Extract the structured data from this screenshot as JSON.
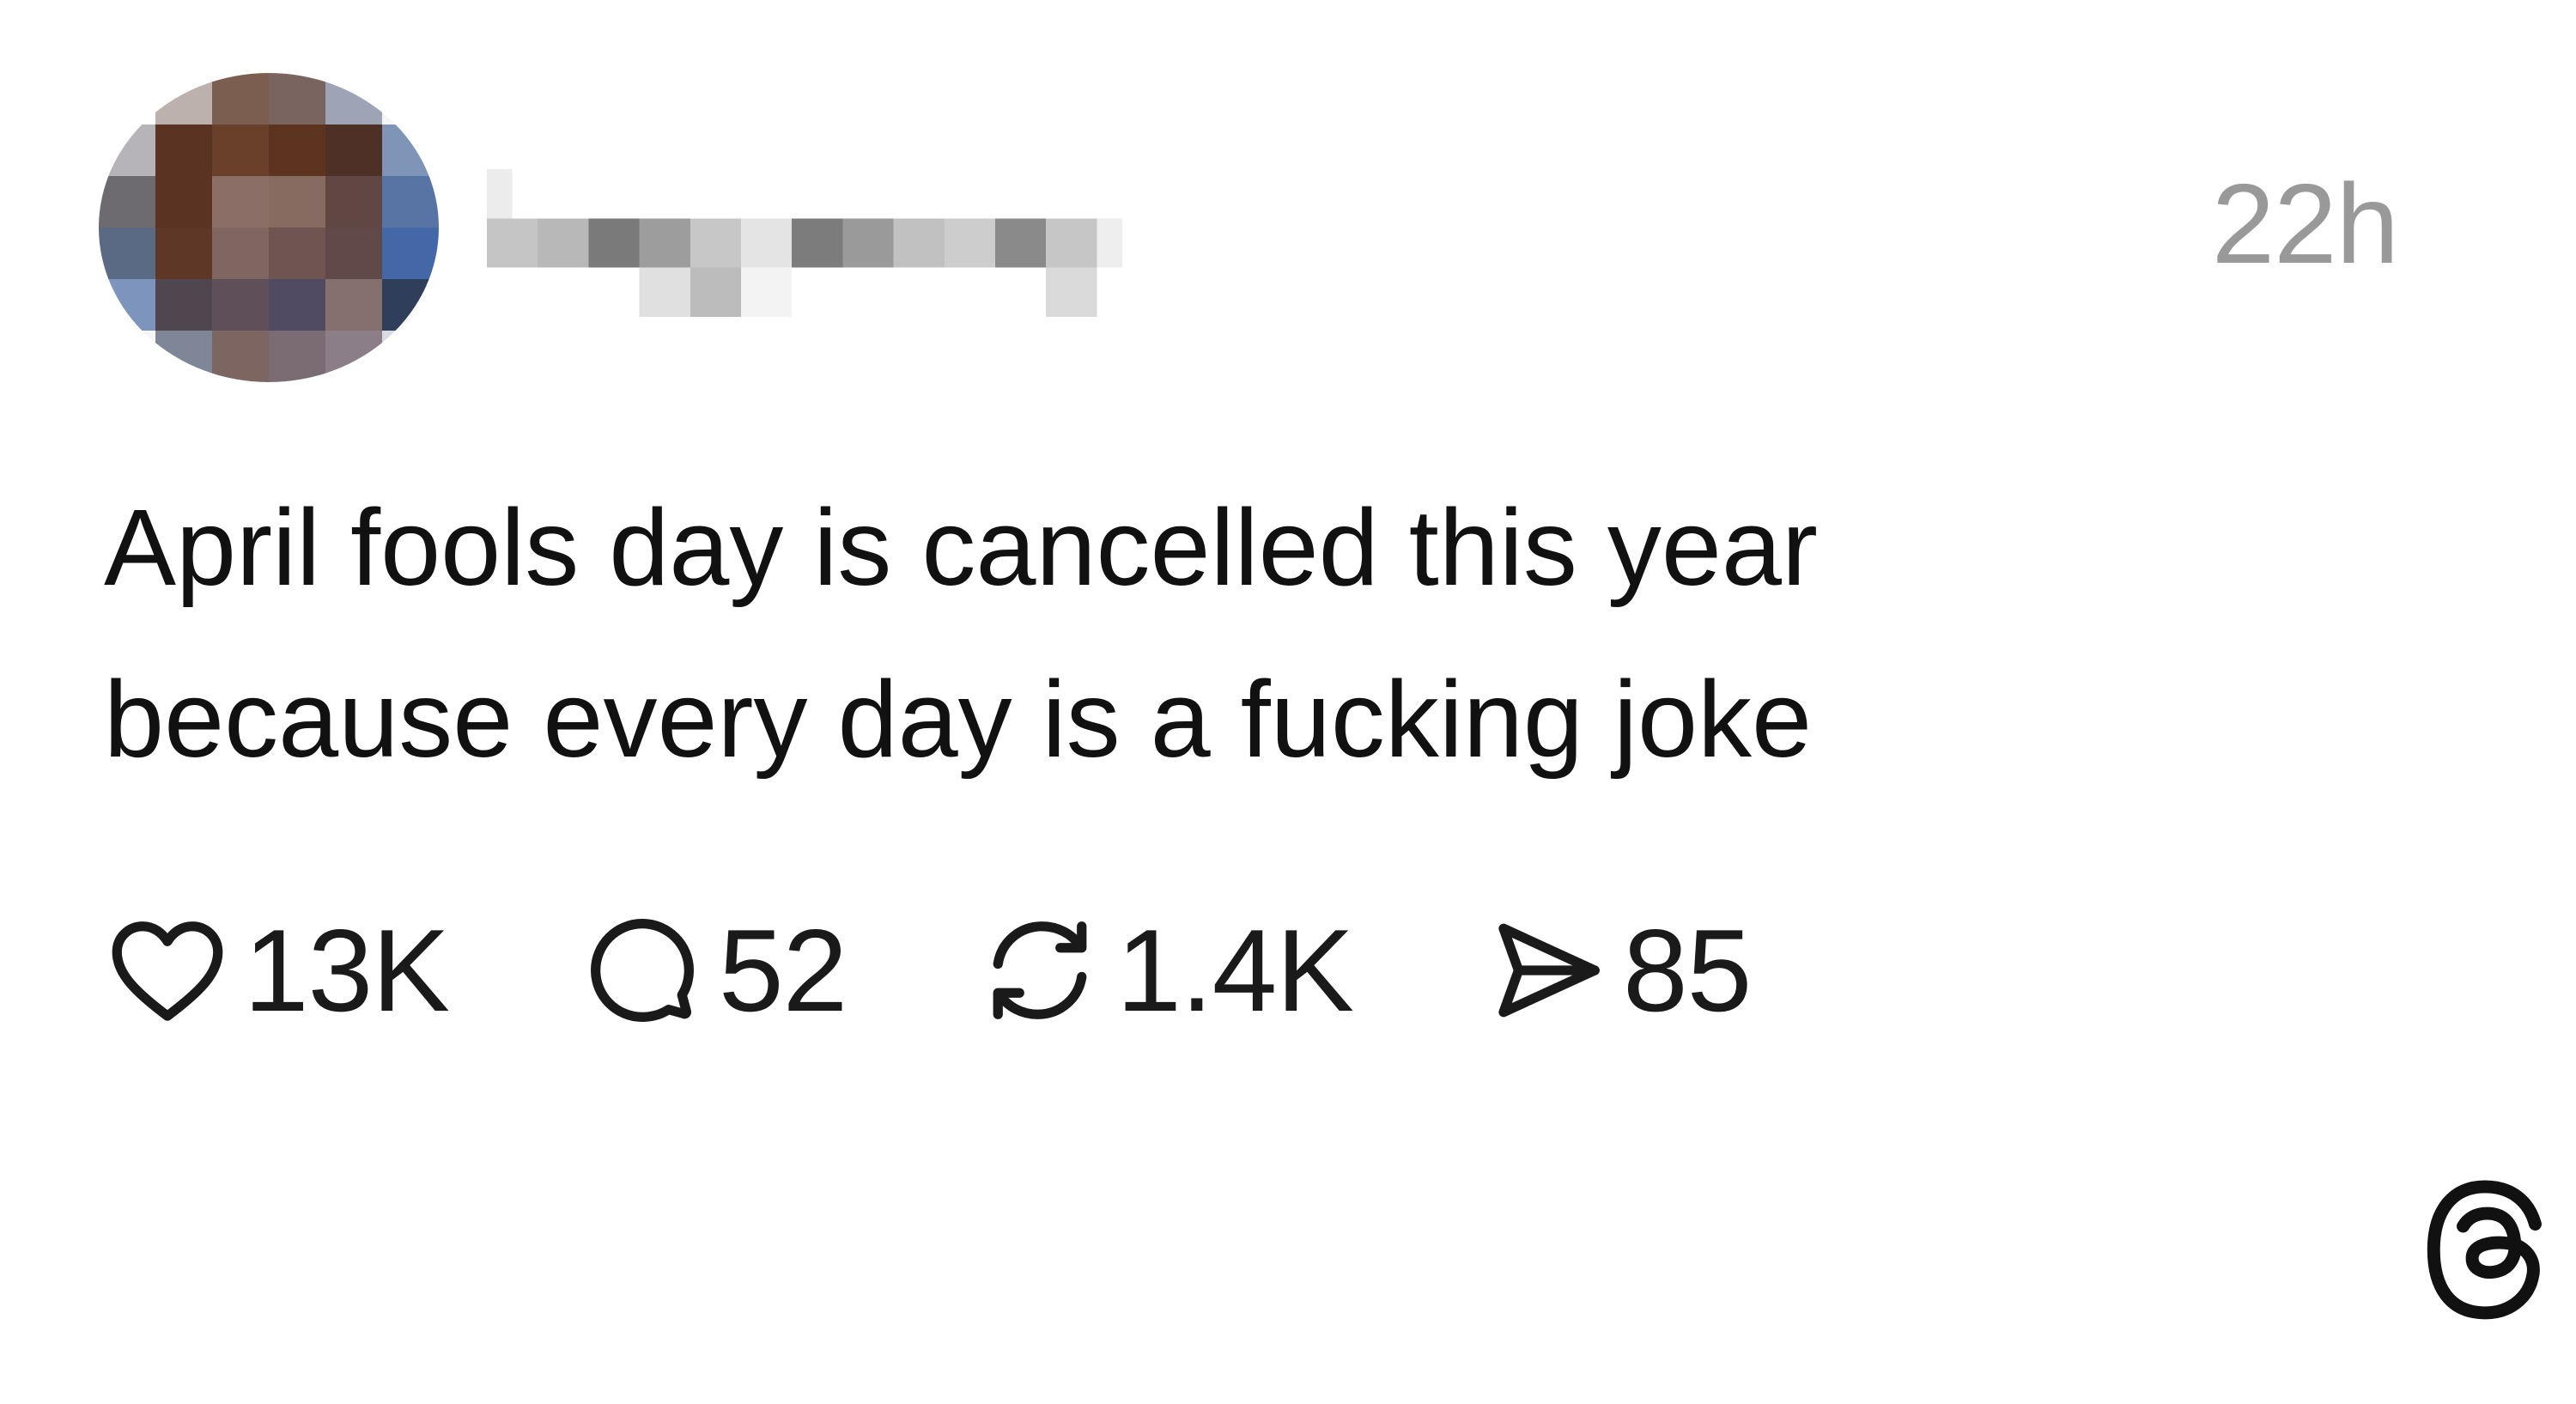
{
  "post": {
    "author_avatar": "pixelated-avatar",
    "author_name_obscured": true,
    "timestamp": "22h",
    "text_lines": [
      "April fools day is cancelled this year",
      "because every day is a fucking joke"
    ]
  },
  "actions": {
    "likes": {
      "icon": "heart-icon",
      "count": "13K"
    },
    "replies": {
      "icon": "comment-icon",
      "count": "52"
    },
    "reposts": {
      "icon": "repost-icon",
      "count": "1.4K"
    },
    "shares": {
      "icon": "send-icon",
      "count": "85"
    }
  },
  "brand": {
    "logo": "threads-logo-icon"
  },
  "colors": {
    "background": "#ffffff",
    "text": "#111111",
    "timestamp": "#999999",
    "icon_stroke": "#1a1a1a"
  }
}
